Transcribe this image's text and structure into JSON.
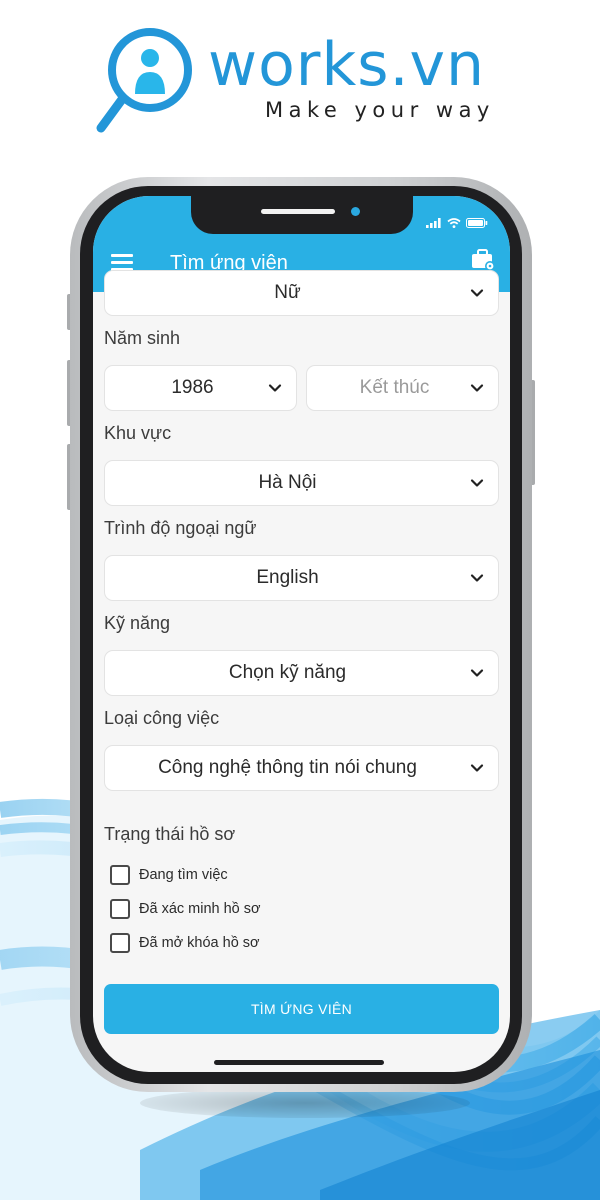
{
  "brand": {
    "name": "works.vn",
    "tagline": "Make your way",
    "color": "#2396d8"
  },
  "appbar": {
    "title": "Tìm ứng viên",
    "color": "#29b0e4",
    "menu_icon": "hamburger-menu-icon",
    "action_icon": "briefcase-settings-icon"
  },
  "form": {
    "gender_select": {
      "value": "Nữ"
    },
    "birth_year": {
      "label": "Năm sinh",
      "start": "1986",
      "end_placeholder": "Kết thúc"
    },
    "region": {
      "label": "Khu vực",
      "value": "Hà Nội"
    },
    "language_level": {
      "label": "Trình độ ngoại ngữ",
      "value": "English"
    },
    "skills": {
      "label": "Kỹ năng",
      "placeholder": "Chọn kỹ năng"
    },
    "job_type": {
      "label": "Loại công việc",
      "value": "Công nghệ thông tin nói chung"
    },
    "profile_status": {
      "label": "Trạng thái hồ sơ",
      "options": [
        {
          "label": "Đang tìm việc",
          "checked": false
        },
        {
          "label": "Đã xác minh hồ sơ",
          "checked": false
        },
        {
          "label": "Đã mở khóa hồ sơ",
          "checked": false
        }
      ]
    },
    "submit_label": "TÌM ỨNG VIÊN"
  }
}
